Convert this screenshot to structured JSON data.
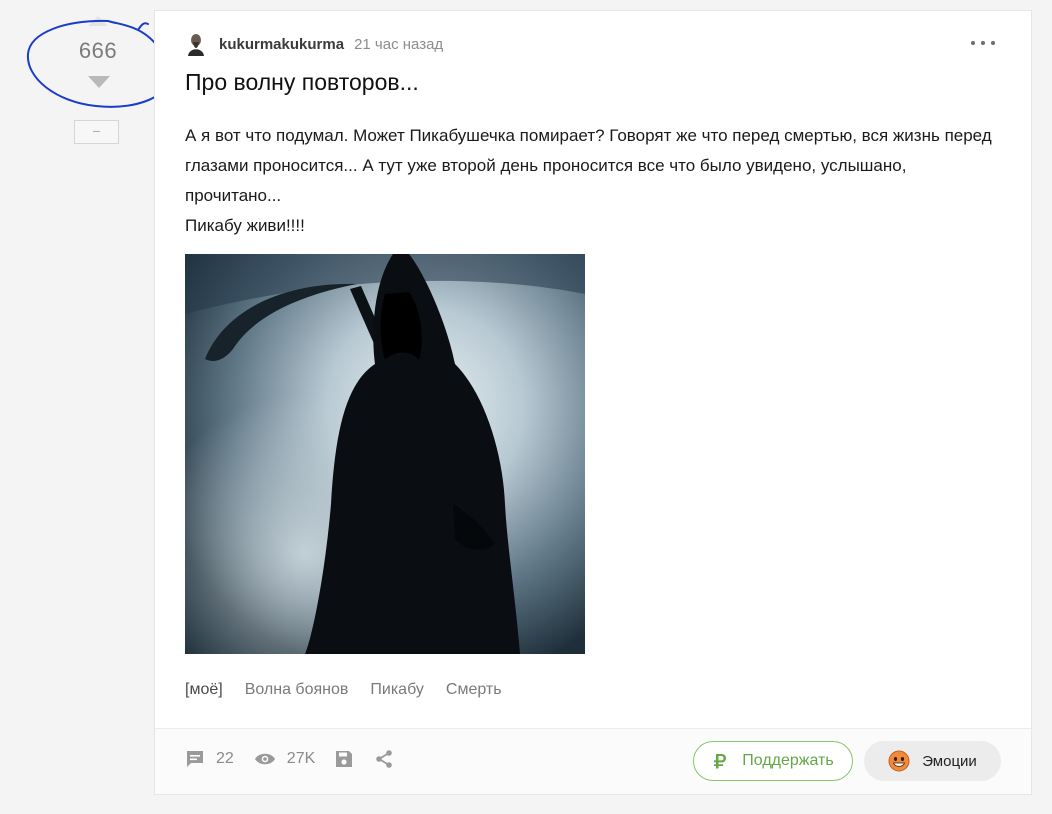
{
  "vote": {
    "rating": "666",
    "collapse_label": "−"
  },
  "story": {
    "author": "kukurmakukurma",
    "time": "21 час назад",
    "title": "Про волну повторов...",
    "content_line_1": "А я вот что подумал. Может Пикабушечка помирает? Говорят же что перед смертью, вся жизнь перед глазами проносится... А тут уже второй день проносится все что было увидено, услышано, прочитано...",
    "content_line_2": "Пикабу живи!!!!",
    "tags": [
      "[моё]",
      "Волна боянов",
      "Пикабу",
      "Смерть"
    ]
  },
  "footer": {
    "comments_count": "22",
    "views_count": "27K",
    "support_label": "Поддержать",
    "emotions_label": "Эмоции"
  },
  "icons": {
    "comments": "comment-icon",
    "views": "eye-icon",
    "save": "save-icon",
    "share": "share-icon",
    "support": "ruble-icon",
    "emotion": "emotion-face-icon"
  },
  "colors": {
    "accent_green": "#65a747",
    "annotation_blue": "#1a3cc8"
  }
}
